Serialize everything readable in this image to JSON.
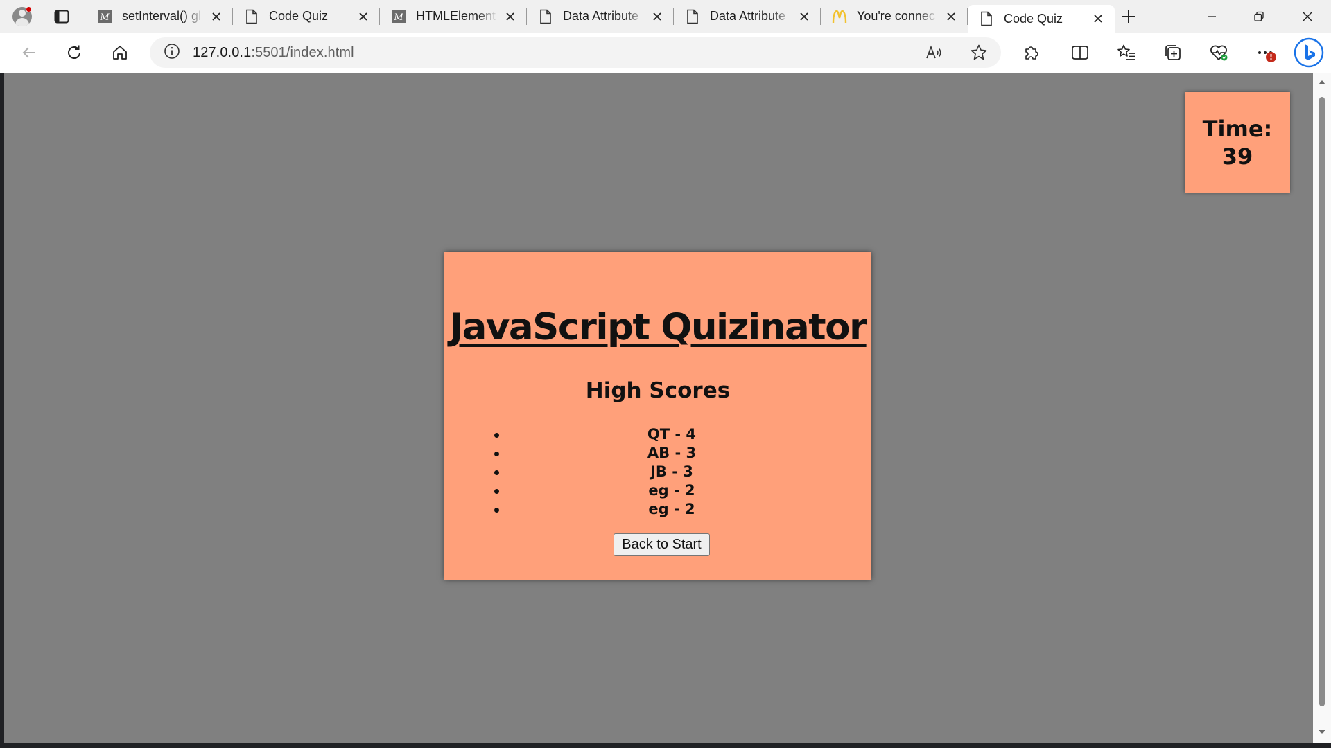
{
  "browser": {
    "tabs": [
      {
        "title": "setInterval() gl",
        "favicon": "mdn-icon",
        "active": false
      },
      {
        "title": "Code Quiz",
        "favicon": "page-icon",
        "active": false
      },
      {
        "title": "HTMLElement",
        "favicon": "mdn-icon",
        "active": false
      },
      {
        "title": "Data Attribute",
        "favicon": "page-icon",
        "active": false
      },
      {
        "title": "Data Attribute",
        "favicon": "page-icon",
        "active": false
      },
      {
        "title": "You're connec",
        "favicon": "mcdonalds-icon",
        "active": false
      },
      {
        "title": "Code Quiz",
        "favicon": "page-icon",
        "active": true
      }
    ],
    "url_host": "127.0.0.1",
    "url_rest": ":5501/index.html",
    "extensions_badge": "!"
  },
  "page": {
    "timer": {
      "label": "Time:",
      "value": "39"
    },
    "title": "JavaScript Quizinator",
    "subtitle": "High Scores",
    "scores": [
      "QT - 4",
      "AB - 3",
      "JB - 3",
      "eg - 2",
      "eg - 2"
    ],
    "back_button": "Back to Start"
  },
  "colors": {
    "card": "#ffa07a",
    "page_background": "#808080"
  }
}
